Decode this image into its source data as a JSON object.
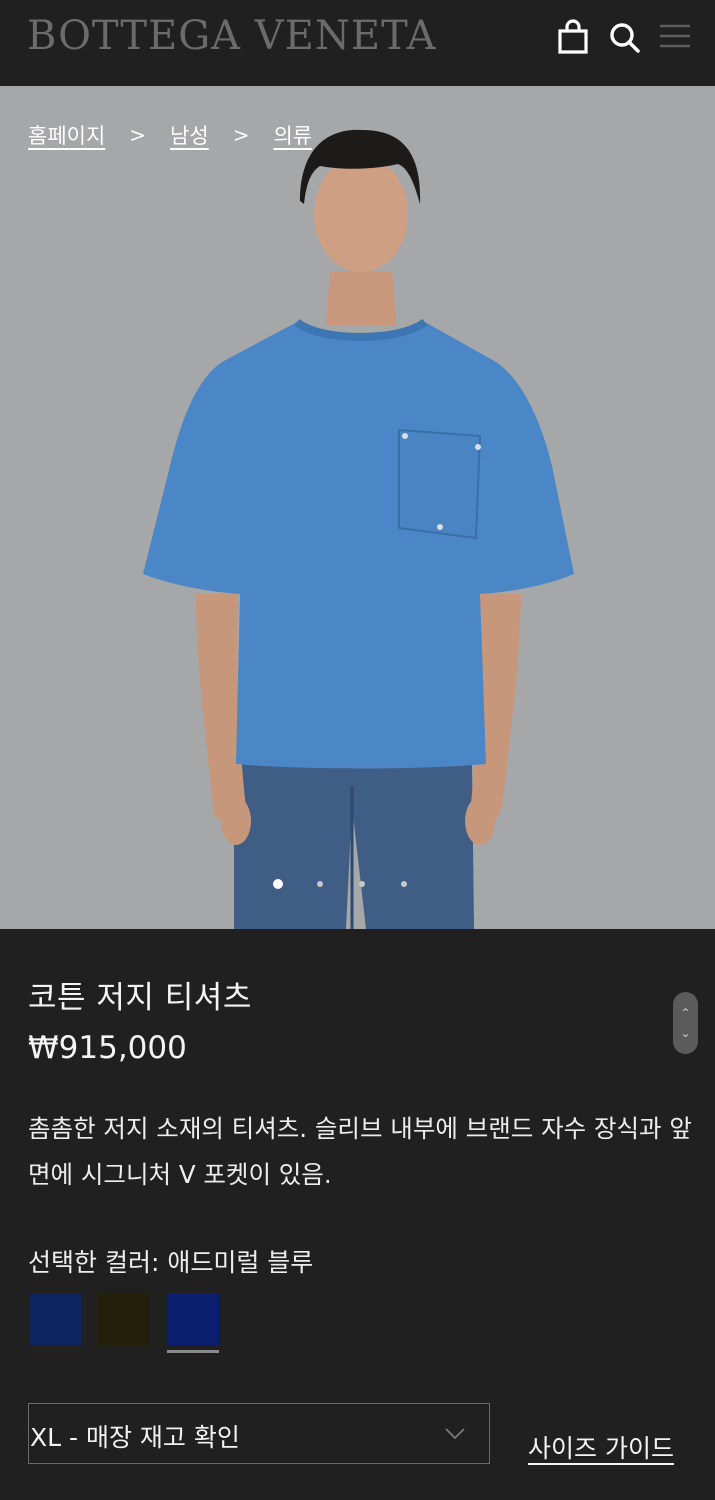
{
  "header": {
    "logo": "BOTTEGA VENETA",
    "icons": [
      "shopping-bag-icon",
      "search-icon",
      "menu-icon"
    ]
  },
  "breadcrumb": {
    "items": [
      "홈페이지",
      "남성",
      "의류"
    ],
    "separator": ">"
  },
  "gallery": {
    "total_slides": 4,
    "active_index": 0
  },
  "product": {
    "name": "코튼 저지 티셔츠",
    "price": "₩915,000",
    "description": "촘촘한 저지 소재의 티셔츠. 슬리브 내부에 브랜드 자수 장식과 앞면에 시그니처 V 포켓이 있음.",
    "selected_color_label": "선택한 컬러: 애드미럴 블루",
    "swatches": [
      {
        "color": "#0e2660",
        "selected": false
      },
      {
        "color": "#241f09",
        "selected": false
      },
      {
        "color": "#0a1e70",
        "selected": true
      }
    ]
  },
  "size": {
    "value": "XL - 매장 재고 확인",
    "guide_label": "사이즈 가이드"
  },
  "colors": {
    "background": "#202020",
    "hero_background": "#a6a7a8",
    "shirt": "#4b87c6"
  }
}
